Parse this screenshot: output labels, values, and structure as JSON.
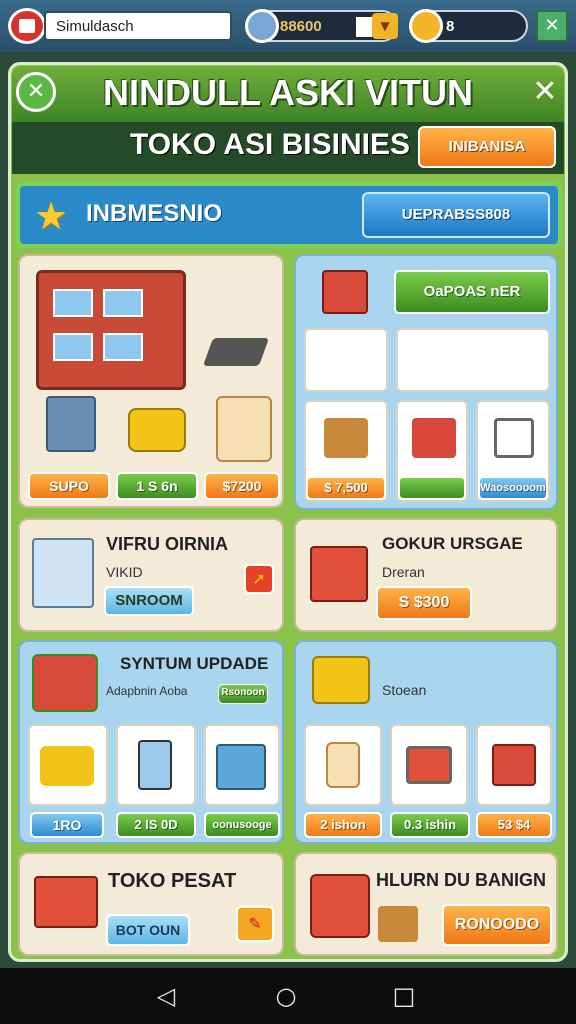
{
  "top_bar": {
    "search_value": "Simuldasch",
    "coins": "88600",
    "gems": "8"
  },
  "header": {
    "title": "NINDULL ASKI VITUN",
    "subtitle": "TOKO ASI BISINIES",
    "subtitle_button": "INIBANISA"
  },
  "banner": {
    "title": "INBMESNIO",
    "button": "UEPRABSS808"
  },
  "store_card": {
    "prices": [
      "SUPO",
      "1 S 6n",
      "$7200"
    ]
  },
  "shop_card": {
    "button": "OaPOAS nER",
    "price": "$ 7,500",
    "tag": "Waosoooom"
  },
  "vifru_card": {
    "title": "VIFRU OIRNIA",
    "line1": "VIKID",
    "button": "SNROOM"
  },
  "gokur_card": {
    "title": "GOKUR URSGAE",
    "line1": "Dreran",
    "price": "S $300"
  },
  "system_card": {
    "title": "SYNTUM UPDADE",
    "line1": "Adapbnin Aoba",
    "tag": "Rsonoon",
    "buttons": [
      "1RO",
      "2 IS 0D",
      "oonusooge"
    ]
  },
  "stoean_card": {
    "title": "Stoean",
    "buttons": [
      "2 ishon",
      "0.3 ishin",
      "53 $4"
    ]
  },
  "toko_card": {
    "title": "TOKO PESAT",
    "button": "BOT OUN"
  },
  "hlurn_card": {
    "title": "HLURN DU BANIGN",
    "button": "RONOODO"
  },
  "colors": {
    "panel_green": "#8bc34a",
    "header_dark": "#244a28",
    "accent_orange": "#f07818",
    "accent_blue": "#2b8ac8"
  }
}
